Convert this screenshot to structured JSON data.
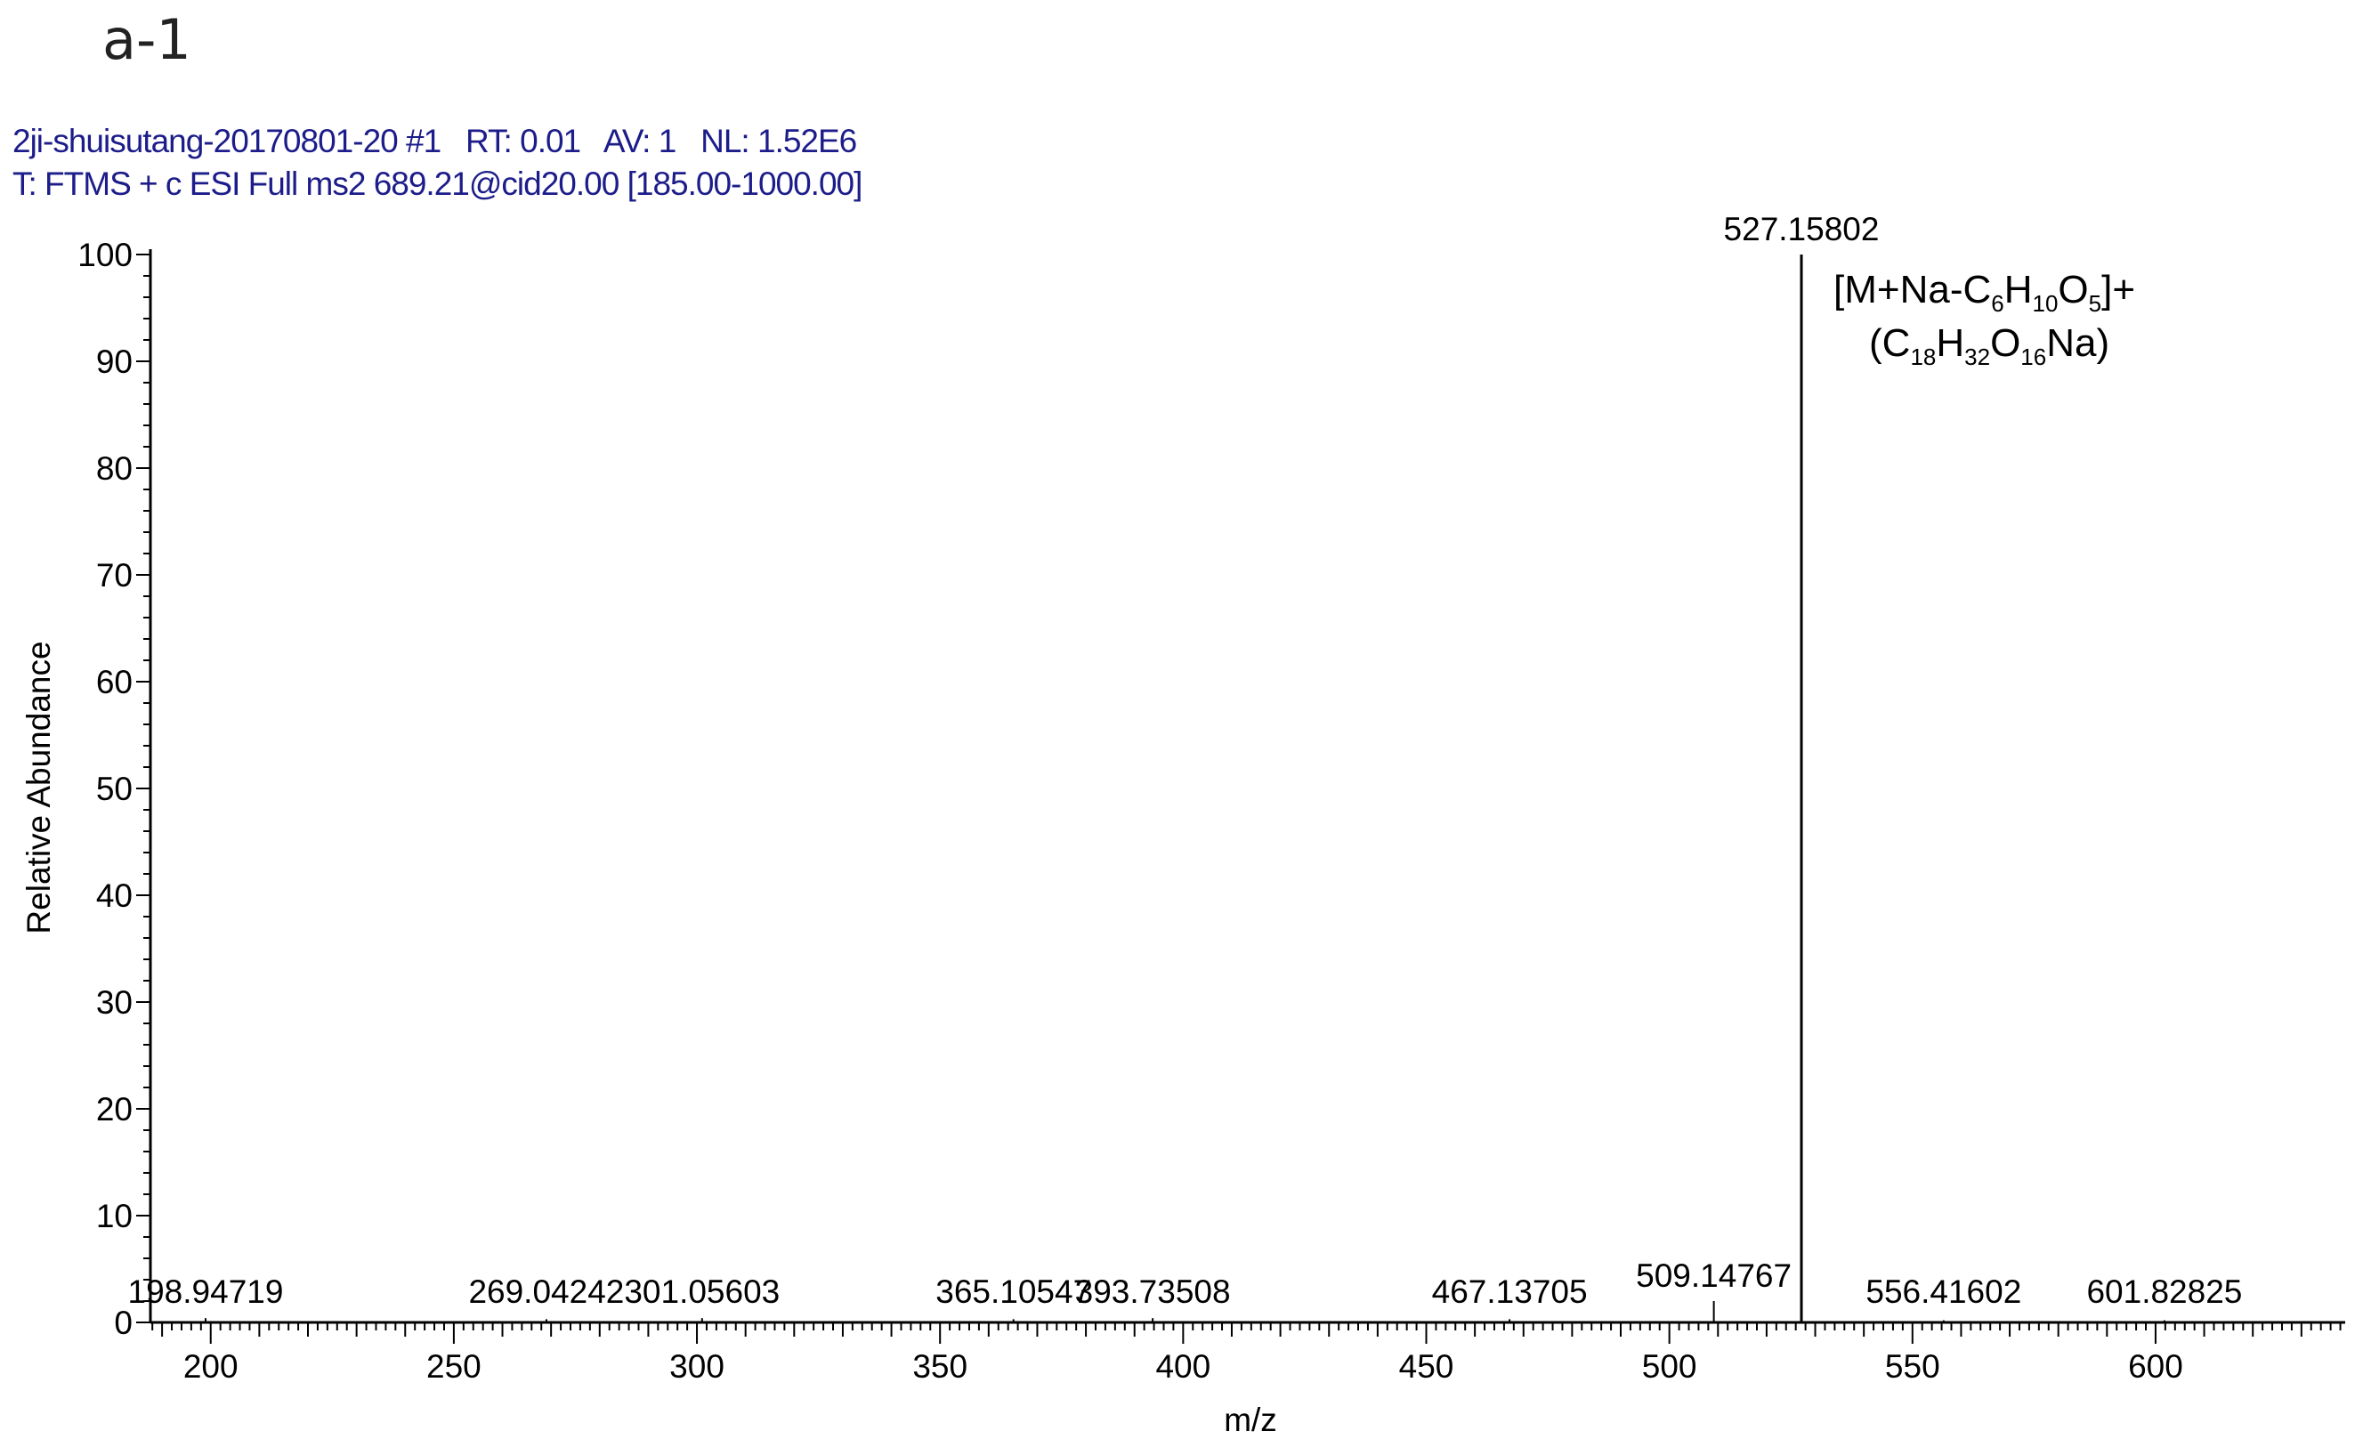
{
  "panel_label": "a-1",
  "header": {
    "line1": "2ji-shuisutang-20170801-20 #1   RT: 0.01   AV: 1   NL: 1.52E6",
    "line2": "T: FTMS + c ESI Full ms2 689.21@cid20.00 [185.00-1000.00]"
  },
  "chart_data": {
    "type": "bar",
    "title": "",
    "xlabel": "m/z",
    "ylabel": "Relative Abundance",
    "xlim": [
      187.6,
      639
    ],
    "ylim": [
      0,
      100
    ],
    "xticks": [
      200,
      250,
      300,
      350,
      400,
      450,
      500,
      550,
      600
    ],
    "yticks": [
      0,
      10,
      20,
      30,
      40,
      50,
      60,
      70,
      80,
      90,
      100
    ],
    "peaks": [
      {
        "mz": 198.94719,
        "abundance": 0.4,
        "label": "198.94719"
      },
      {
        "mz": 269.04242,
        "abundance": 0.3,
        "label": "269.04242"
      },
      {
        "mz": 301.05603,
        "abundance": 0.4,
        "label": "301.05603"
      },
      {
        "mz": 365.10547,
        "abundance": 0.3,
        "label": "365.10547"
      },
      {
        "mz": 393.73508,
        "abundance": 0.4,
        "label": "393.73508"
      },
      {
        "mz": 467.13705,
        "abundance": 0.3,
        "label": "467.13705"
      },
      {
        "mz": 509.14767,
        "abundance": 2.0,
        "label": "509.14767"
      },
      {
        "mz": 527.15802,
        "abundance": 100,
        "label": "527.15802"
      },
      {
        "mz": 556.41602,
        "abundance": 0.2,
        "label": "556.41602"
      },
      {
        "mz": 601.82825,
        "abundance": 0.2,
        "label": "601.82825"
      }
    ],
    "annotation": {
      "line1": "[M+Na-C6H10O5]+",
      "line2": "(C18H32O16Na)"
    }
  }
}
